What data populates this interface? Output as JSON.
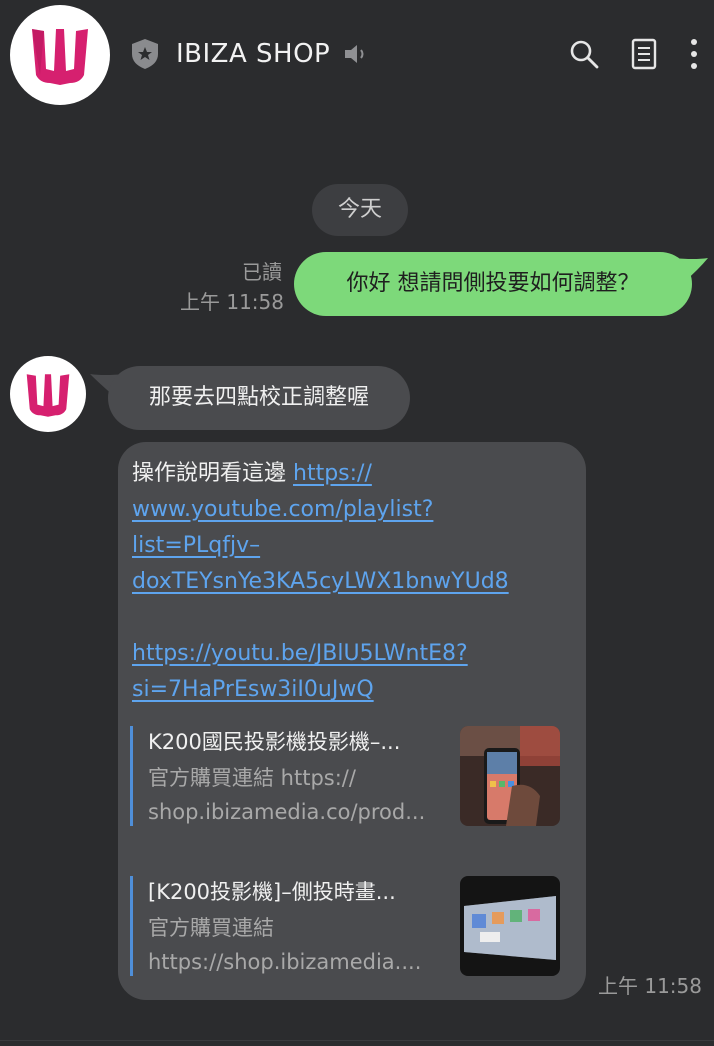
{
  "header": {
    "title": "IBIZA SHOP",
    "avatar_icon": "ibiza-trident-logo",
    "badge_icon": "official-shield-icon",
    "speaker_icon": "speaker-icon",
    "actions": [
      "search-icon",
      "notes-icon",
      "more-icon"
    ]
  },
  "date_separator": "今天",
  "outgoing": {
    "read_label": "已讀",
    "time": "上午 11:58",
    "text": "你好 想請問側投要如何調整？"
  },
  "incoming": {
    "first_text": "那要去四點校正調整喔",
    "second": {
      "prefix": "操作說明看這邊 ",
      "link1_lines": [
        "https://",
        "www.youtube.com/playlist?",
        "list=PLqfjv–",
        "doxTEYsnYe3KA5cyLWX1bnwYUd8"
      ],
      "link2_lines": [
        "https://youtu.be/JBlU5LWntE8?",
        "si=7HaPrEsw3iI0uJwQ"
      ]
    },
    "cards": [
      {
        "title": "K200國民投影機投影機–...",
        "desc": "官方購買連結 https://",
        "url": "shop.ibizamedia.co/prod..."
      },
      {
        "title": "[K200投影機]–側投時畫...",
        "desc": "官方購買連結",
        "url": "https://shop.ibizamedia...."
      }
    ],
    "time": "上午 11:58"
  },
  "colors": {
    "background": "#2b2c2e",
    "outgoing_bubble": "#7dd97a",
    "incoming_bubble": "#4a4b4e",
    "link": "#5ea4ee",
    "brand_magenta": "#d6206f"
  }
}
